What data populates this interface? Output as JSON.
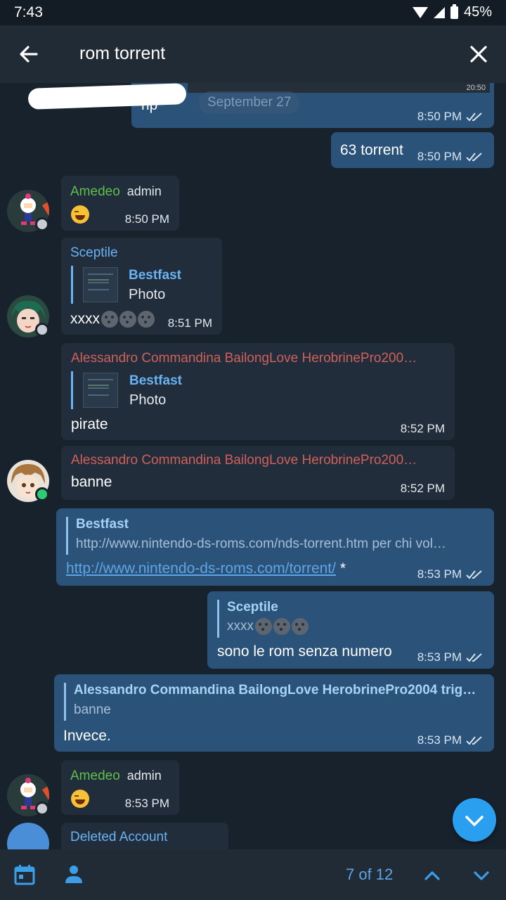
{
  "status_bar": {
    "time": "7:43",
    "battery": "45%"
  },
  "search": {
    "query": "rom torrent"
  },
  "messages": {
    "m1": {
      "text": "rip",
      "time": "8:50 PM",
      "screenshot_time": "20:50",
      "date_pill": "September 27"
    },
    "m2": {
      "text": "63 torrent",
      "time": "8:50 PM"
    },
    "m3": {
      "sender": "Amedeo",
      "role": "admin",
      "time": "8:50 PM"
    },
    "m4": {
      "sender": "Sceptile",
      "reply_name": "Bestfast",
      "reply_text": "Photo",
      "text": "xxxx",
      "time": "8:51 PM"
    },
    "m5": {
      "sender": "Alessandro Commandina BailongLove HerobrinePro200…",
      "reply_name": "Bestfast",
      "reply_text": "Photo",
      "text": "pirate",
      "time": "8:52 PM"
    },
    "m6": {
      "sender": "Alessandro Commandina BailongLove HerobrinePro200…",
      "text": "banne",
      "time": "8:52 PM"
    },
    "m7": {
      "reply_name": "Bestfast",
      "reply_text": "http://www.nintendo-ds-roms.com/nds-torrent.htm per chi vol…",
      "link": "http://www.nintendo-ds-roms.com/torrent/",
      "suffix": " *",
      "time": "8:53 PM"
    },
    "m8": {
      "reply_name": "Sceptile",
      "reply_text": "xxxx",
      "text": "sono le rom senza numero",
      "time": "8:53 PM"
    },
    "m9": {
      "reply_name": "Alessandro Commandina BailongLove HerobrinePro2004 trig…",
      "reply_text": "banne",
      "text": "Invece.",
      "time": "8:53 PM"
    },
    "m10": {
      "sender": "Amedeo",
      "role": "admin",
      "time": "8:53 PM"
    },
    "m11": {
      "sender": "Deleted Account"
    }
  },
  "bottom": {
    "counter": "7 of 12"
  },
  "colors": {
    "background": "#18222d",
    "bar": "#202b36",
    "outgoing": "#2b5278",
    "incoming": "#212d3b",
    "accent": "#5ea5e6",
    "name_green": "#5fbf4b",
    "name_blue": "#6ab3f3",
    "name_red": "#d0605a"
  },
  "icons": [
    "back-arrow-icon",
    "close-icon",
    "double-check-icon",
    "calendar-icon",
    "person-icon",
    "chevron-up-icon",
    "chevron-down-icon",
    "smile-emoji-icon",
    "moon-emoji-icon"
  ]
}
